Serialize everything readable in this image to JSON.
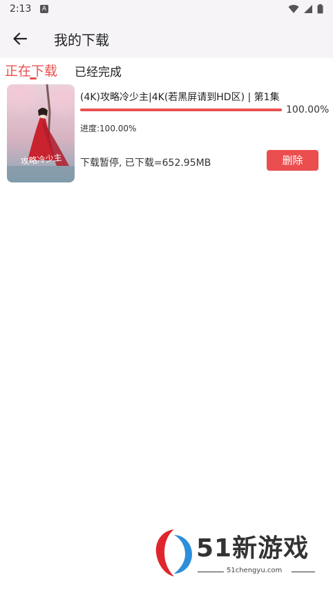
{
  "status_bar": {
    "time": "2:13",
    "notification_icon": "a-icon",
    "icons": [
      "wifi-icon",
      "signal-icon",
      "battery-icon"
    ]
  },
  "header": {
    "back_icon": "arrow-left-icon",
    "title": "我的下载"
  },
  "tabs": [
    {
      "label": "正在下载",
      "active": true
    },
    {
      "label": "已经完成",
      "active": false
    }
  ],
  "downloads": [
    {
      "title": "(4K)攻略冷少主|4K(若黑屏请到HD区) | 第1集",
      "progress_percent": 100,
      "progress_text": "100.00%",
      "progress_label": "进度:100.00%",
      "status": "下载暂停, 已下载=652.95MB",
      "delete_label": "删除",
      "poster_title": "攻略冷少主"
    }
  ],
  "watermark": {
    "brand": "51新游戏",
    "site": "51chengyu.com"
  },
  "colors": {
    "accent": "#e9504f",
    "app_bar_bg": "#f6f4f7",
    "text": "#222222"
  }
}
